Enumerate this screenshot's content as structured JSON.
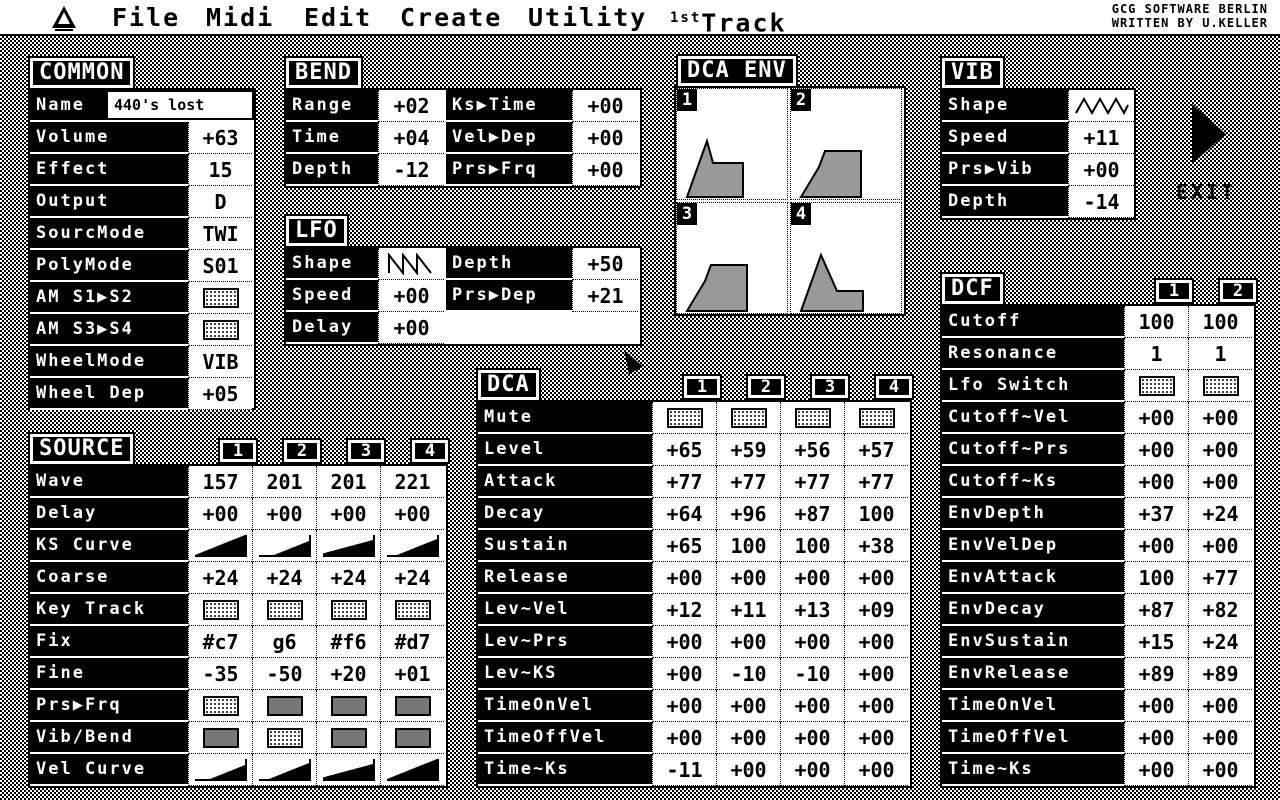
{
  "menubar": {
    "items": [
      "File",
      "Midi",
      "Edit",
      "Create",
      "Utility"
    ],
    "track_sup": "1st",
    "track_label": "Track",
    "credit1": "GCG SOFTWARE BERLIN",
    "credit2": "WRITTEN BY U.KELLER"
  },
  "common": {
    "title": "COMMON",
    "name_label": "Name",
    "name_value": "440's lost",
    "rows": [
      {
        "label": "Volume",
        "value": "+63"
      },
      {
        "label": "Effect",
        "value": "15"
      },
      {
        "label": "Output",
        "value": "D"
      },
      {
        "label": "SourcMode",
        "value": "TWI"
      },
      {
        "label": "PolyMode",
        "value": "S01"
      },
      {
        "label": "AM S1▶S2",
        "value": ""
      },
      {
        "label": "AM S3▶S4",
        "value": ""
      },
      {
        "label": "WheelMode",
        "value": "VIB"
      },
      {
        "label": "Wheel Dep",
        "value": "+05"
      }
    ]
  },
  "bend": {
    "title": "BEND",
    "left": [
      {
        "label": "Range",
        "value": "+02"
      },
      {
        "label": "Time",
        "value": "+04"
      },
      {
        "label": "Depth",
        "value": "-12"
      }
    ],
    "right": [
      {
        "label": "Ks▶Time",
        "value": "+00"
      },
      {
        "label": "Vel▶Dep",
        "value": "+00"
      },
      {
        "label": "Prs▶Frq",
        "value": "+00"
      }
    ]
  },
  "lfo": {
    "title": "LFO",
    "left": [
      {
        "label": "Shape",
        "value": ""
      },
      {
        "label": "Speed",
        "value": "+00"
      },
      {
        "label": "Delay",
        "value": "+00"
      }
    ],
    "right": [
      {
        "label": "Depth",
        "value": "+50"
      },
      {
        "label": "Prs▶Dep",
        "value": "+21"
      }
    ]
  },
  "dca_env": {
    "title": "DCA ENV",
    "cells": [
      "1",
      "2",
      "3",
      "4"
    ]
  },
  "vib": {
    "title": "VIB",
    "rows": [
      {
        "label": "Shape",
        "value": ""
      },
      {
        "label": "Speed",
        "value": "+11"
      },
      {
        "label": "Prs▶Vib",
        "value": "+00"
      },
      {
        "label": "Depth",
        "value": "-14"
      }
    ]
  },
  "exit_label": "EXIT",
  "source": {
    "title": "SOURCE",
    "columns": [
      "1",
      "2",
      "3",
      "4"
    ],
    "rows": [
      {
        "label": "Wave",
        "values": [
          "157",
          "201",
          "201",
          "221"
        ]
      },
      {
        "label": "Delay",
        "values": [
          "+00",
          "+00",
          "+00",
          "+00"
        ]
      },
      {
        "label": "KS Curve",
        "values": [
          "",
          "",
          "",
          ""
        ]
      },
      {
        "label": "Coarse",
        "values": [
          "+24",
          "+24",
          "+24",
          "+24"
        ]
      },
      {
        "label": "Key Track",
        "values": [
          "",
          "",
          "",
          ""
        ]
      },
      {
        "label": "Fix",
        "values": [
          "#c7",
          "g6",
          "#f6",
          "#d7"
        ]
      },
      {
        "label": "Fine",
        "values": [
          "-35",
          "-50",
          "+20",
          "+01"
        ]
      },
      {
        "label": "Prs▶Frq",
        "values": [
          "",
          "",
          "",
          ""
        ]
      },
      {
        "label": "Vib/Bend",
        "values": [
          "",
          "",
          "",
          ""
        ]
      },
      {
        "label": "Vel Curve",
        "values": [
          "",
          "",
          "",
          ""
        ]
      }
    ]
  },
  "dca": {
    "title": "DCA",
    "columns": [
      "1",
      "2",
      "3",
      "4"
    ],
    "rows": [
      {
        "label": "Mute",
        "values": [
          "",
          "",
          "",
          ""
        ]
      },
      {
        "label": "Level",
        "values": [
          "+65",
          "+59",
          "+56",
          "+57"
        ]
      },
      {
        "label": "Attack",
        "values": [
          "+77",
          "+77",
          "+77",
          "+77"
        ]
      },
      {
        "label": "Decay",
        "values": [
          "+64",
          "+96",
          "+87",
          "100"
        ]
      },
      {
        "label": "Sustain",
        "values": [
          "+65",
          "100",
          "100",
          "+38"
        ]
      },
      {
        "label": "Release",
        "values": [
          "+00",
          "+00",
          "+00",
          "+00"
        ]
      },
      {
        "label": "Lev~Vel",
        "values": [
          "+12",
          "+11",
          "+13",
          "+09"
        ]
      },
      {
        "label": "Lev~Prs",
        "values": [
          "+00",
          "+00",
          "+00",
          "+00"
        ]
      },
      {
        "label": "Lev~KS",
        "values": [
          "+00",
          "-10",
          "-10",
          "+00"
        ]
      },
      {
        "label": "TimeOnVel",
        "values": [
          "+00",
          "+00",
          "+00",
          "+00"
        ]
      },
      {
        "label": "TimeOffVel",
        "values": [
          "+00",
          "+00",
          "+00",
          "+00"
        ]
      },
      {
        "label": "Time~Ks",
        "values": [
          "-11",
          "+00",
          "+00",
          "+00"
        ]
      }
    ]
  },
  "dcf": {
    "title": "DCF",
    "columns": [
      "1",
      "2"
    ],
    "rows": [
      {
        "label": "Cutoff",
        "values": [
          "100",
          "100"
        ]
      },
      {
        "label": "Resonance",
        "values": [
          "1",
          "1"
        ]
      },
      {
        "label": "Lfo Switch",
        "values": [
          "",
          ""
        ]
      },
      {
        "label": "Cutoff~Vel",
        "values": [
          "+00",
          "+00"
        ]
      },
      {
        "label": "Cutoff~Prs",
        "values": [
          "+00",
          "+00"
        ]
      },
      {
        "label": "Cutoff~Ks",
        "values": [
          "+00",
          "+00"
        ]
      },
      {
        "label": "EnvDepth",
        "values": [
          "+37",
          "+24"
        ]
      },
      {
        "label": "EnvVelDep",
        "values": [
          "+00",
          "+00"
        ]
      },
      {
        "label": "EnvAttack",
        "values": [
          "100",
          "+77"
        ]
      },
      {
        "label": "EnvDecay",
        "values": [
          "+87",
          "+82"
        ]
      },
      {
        "label": "EnvSustain",
        "values": [
          "+15",
          "+24"
        ]
      },
      {
        "label": "EnvRelease",
        "values": [
          "+89",
          "+89"
        ]
      },
      {
        "label": "TimeOnVel",
        "values": [
          "+00",
          "+00"
        ]
      },
      {
        "label": "TimeOffVel",
        "values": [
          "+00",
          "+00"
        ]
      },
      {
        "label": "Time~Ks",
        "values": [
          "+00",
          "+00"
        ]
      }
    ]
  }
}
